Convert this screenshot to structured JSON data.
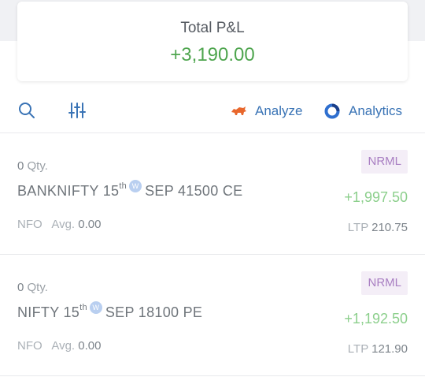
{
  "summary": {
    "label": "Total P&L",
    "value": "+3,190.00",
    "value_color": "#4ea54e"
  },
  "toolbar": {
    "search_icon": "search-icon",
    "filter_icon": "sliders-icon",
    "analyze_label": "Analyze",
    "analyze_icon": "bull-icon",
    "analytics_label": "Analytics",
    "analytics_icon": "analytics-ring-icon",
    "accent": "#3973b5"
  },
  "positions": [
    {
      "qty": "0",
      "qty_label": "Qty.",
      "symbol_prefix": "BANKNIFTY 15",
      "symbol_sup": "th",
      "weekly_badge": "W",
      "symbol_suffix": "SEP 41500 CE",
      "exchange": "NFO",
      "avg_label": "Avg.",
      "avg": "0.00",
      "product": "NRML",
      "pnl": "+1,997.50",
      "ltp_label": "LTP",
      "ltp": "210.75"
    },
    {
      "qty": "0",
      "qty_label": "Qty.",
      "symbol_prefix": "NIFTY 15",
      "symbol_sup": "th",
      "weekly_badge": "W",
      "symbol_suffix": "SEP 18100 PE",
      "exchange": "NFO",
      "avg_label": "Avg.",
      "avg": "0.00",
      "product": "NRML",
      "pnl": "+1,192.50",
      "ltp_label": "LTP",
      "ltp": "121.90"
    }
  ]
}
